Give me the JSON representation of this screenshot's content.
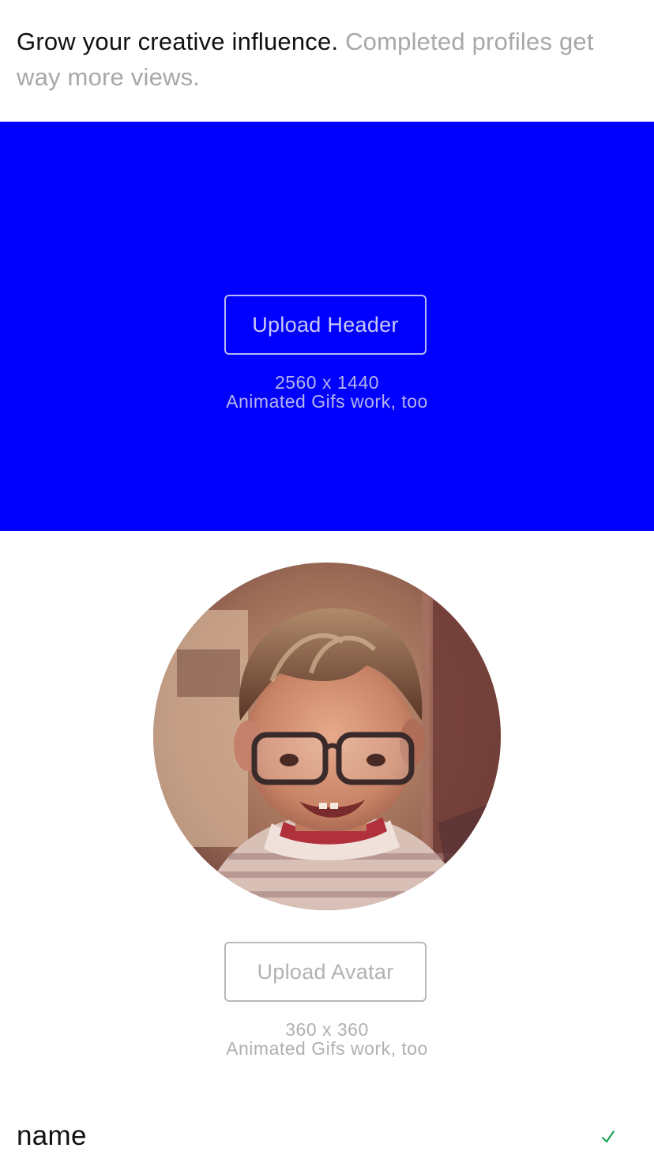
{
  "intro": {
    "lead": "Grow your creative influence.",
    "rest": "Completed profiles get way more views."
  },
  "header_upload": {
    "button_label": "Upload Header",
    "size": "2560 x 1440",
    "note": "Animated Gifs work, too"
  },
  "avatar_upload": {
    "button_label": "Upload Avatar",
    "size": "360 x 360",
    "note": "Animated Gifs work, too"
  },
  "name_field": {
    "label": "name",
    "status_icon": "check-icon"
  },
  "colors": {
    "header_background": "#0000ff",
    "valid_check": "#1aa35a",
    "muted_text": "#a8a8a8"
  }
}
